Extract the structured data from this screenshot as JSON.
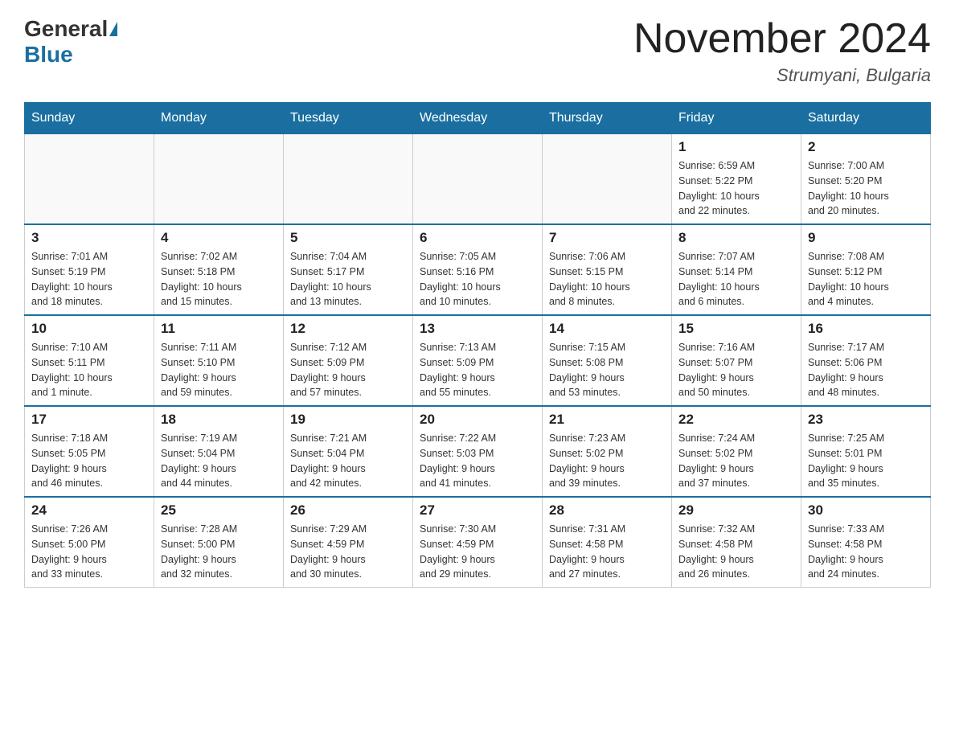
{
  "header": {
    "logo_general": "General",
    "logo_blue": "Blue",
    "month_title": "November 2024",
    "location": "Strumyani, Bulgaria"
  },
  "days_of_week": [
    "Sunday",
    "Monday",
    "Tuesday",
    "Wednesday",
    "Thursday",
    "Friday",
    "Saturday"
  ],
  "weeks": [
    {
      "days": [
        {
          "num": "",
          "info": ""
        },
        {
          "num": "",
          "info": ""
        },
        {
          "num": "",
          "info": ""
        },
        {
          "num": "",
          "info": ""
        },
        {
          "num": "",
          "info": ""
        },
        {
          "num": "1",
          "info": "Sunrise: 6:59 AM\nSunset: 5:22 PM\nDaylight: 10 hours\nand 22 minutes."
        },
        {
          "num": "2",
          "info": "Sunrise: 7:00 AM\nSunset: 5:20 PM\nDaylight: 10 hours\nand 20 minutes."
        }
      ]
    },
    {
      "days": [
        {
          "num": "3",
          "info": "Sunrise: 7:01 AM\nSunset: 5:19 PM\nDaylight: 10 hours\nand 18 minutes."
        },
        {
          "num": "4",
          "info": "Sunrise: 7:02 AM\nSunset: 5:18 PM\nDaylight: 10 hours\nand 15 minutes."
        },
        {
          "num": "5",
          "info": "Sunrise: 7:04 AM\nSunset: 5:17 PM\nDaylight: 10 hours\nand 13 minutes."
        },
        {
          "num": "6",
          "info": "Sunrise: 7:05 AM\nSunset: 5:16 PM\nDaylight: 10 hours\nand 10 minutes."
        },
        {
          "num": "7",
          "info": "Sunrise: 7:06 AM\nSunset: 5:15 PM\nDaylight: 10 hours\nand 8 minutes."
        },
        {
          "num": "8",
          "info": "Sunrise: 7:07 AM\nSunset: 5:14 PM\nDaylight: 10 hours\nand 6 minutes."
        },
        {
          "num": "9",
          "info": "Sunrise: 7:08 AM\nSunset: 5:12 PM\nDaylight: 10 hours\nand 4 minutes."
        }
      ]
    },
    {
      "days": [
        {
          "num": "10",
          "info": "Sunrise: 7:10 AM\nSunset: 5:11 PM\nDaylight: 10 hours\nand 1 minute."
        },
        {
          "num": "11",
          "info": "Sunrise: 7:11 AM\nSunset: 5:10 PM\nDaylight: 9 hours\nand 59 minutes."
        },
        {
          "num": "12",
          "info": "Sunrise: 7:12 AM\nSunset: 5:09 PM\nDaylight: 9 hours\nand 57 minutes."
        },
        {
          "num": "13",
          "info": "Sunrise: 7:13 AM\nSunset: 5:09 PM\nDaylight: 9 hours\nand 55 minutes."
        },
        {
          "num": "14",
          "info": "Sunrise: 7:15 AM\nSunset: 5:08 PM\nDaylight: 9 hours\nand 53 minutes."
        },
        {
          "num": "15",
          "info": "Sunrise: 7:16 AM\nSunset: 5:07 PM\nDaylight: 9 hours\nand 50 minutes."
        },
        {
          "num": "16",
          "info": "Sunrise: 7:17 AM\nSunset: 5:06 PM\nDaylight: 9 hours\nand 48 minutes."
        }
      ]
    },
    {
      "days": [
        {
          "num": "17",
          "info": "Sunrise: 7:18 AM\nSunset: 5:05 PM\nDaylight: 9 hours\nand 46 minutes."
        },
        {
          "num": "18",
          "info": "Sunrise: 7:19 AM\nSunset: 5:04 PM\nDaylight: 9 hours\nand 44 minutes."
        },
        {
          "num": "19",
          "info": "Sunrise: 7:21 AM\nSunset: 5:04 PM\nDaylight: 9 hours\nand 42 minutes."
        },
        {
          "num": "20",
          "info": "Sunrise: 7:22 AM\nSunset: 5:03 PM\nDaylight: 9 hours\nand 41 minutes."
        },
        {
          "num": "21",
          "info": "Sunrise: 7:23 AM\nSunset: 5:02 PM\nDaylight: 9 hours\nand 39 minutes."
        },
        {
          "num": "22",
          "info": "Sunrise: 7:24 AM\nSunset: 5:02 PM\nDaylight: 9 hours\nand 37 minutes."
        },
        {
          "num": "23",
          "info": "Sunrise: 7:25 AM\nSunset: 5:01 PM\nDaylight: 9 hours\nand 35 minutes."
        }
      ]
    },
    {
      "days": [
        {
          "num": "24",
          "info": "Sunrise: 7:26 AM\nSunset: 5:00 PM\nDaylight: 9 hours\nand 33 minutes."
        },
        {
          "num": "25",
          "info": "Sunrise: 7:28 AM\nSunset: 5:00 PM\nDaylight: 9 hours\nand 32 minutes."
        },
        {
          "num": "26",
          "info": "Sunrise: 7:29 AM\nSunset: 4:59 PM\nDaylight: 9 hours\nand 30 minutes."
        },
        {
          "num": "27",
          "info": "Sunrise: 7:30 AM\nSunset: 4:59 PM\nDaylight: 9 hours\nand 29 minutes."
        },
        {
          "num": "28",
          "info": "Sunrise: 7:31 AM\nSunset: 4:58 PM\nDaylight: 9 hours\nand 27 minutes."
        },
        {
          "num": "29",
          "info": "Sunrise: 7:32 AM\nSunset: 4:58 PM\nDaylight: 9 hours\nand 26 minutes."
        },
        {
          "num": "30",
          "info": "Sunrise: 7:33 AM\nSunset: 4:58 PM\nDaylight: 9 hours\nand 24 minutes."
        }
      ]
    }
  ]
}
